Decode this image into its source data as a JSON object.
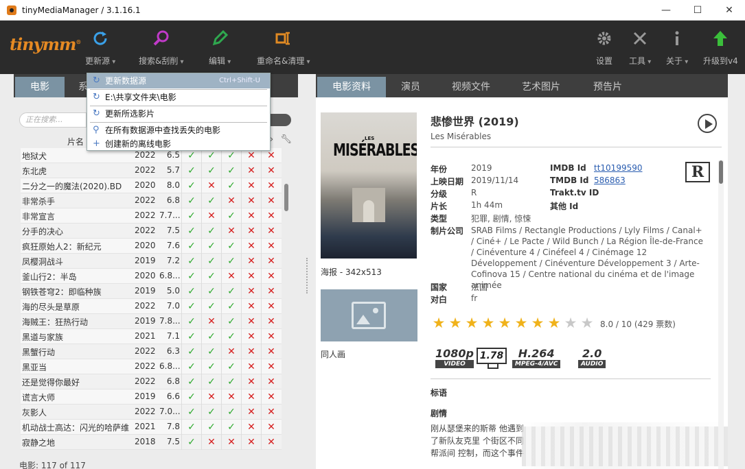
{
  "window": {
    "title": "tinyMediaManager / 3.1.16.1",
    "controls": [
      "—",
      "☐",
      "✕"
    ]
  },
  "toolbar": {
    "logo": "tinymm",
    "logo_mark": "®",
    "buttons": [
      {
        "label": "更新源",
        "icon": "refresh-icon"
      },
      {
        "label": "搜索&刮削",
        "icon": "search-icon"
      },
      {
        "label": "编辑",
        "icon": "pencil-icon"
      },
      {
        "label": "重命名&清理",
        "icon": "rename-icon"
      },
      {
        "label": "设置",
        "icon": "gear-icon"
      },
      {
        "label": "工具",
        "icon": "tools-icon"
      },
      {
        "label": "关于",
        "icon": "info-icon"
      },
      {
        "label": "升级到v4",
        "icon": "upgrade-arrow-icon"
      }
    ],
    "colors": {
      "refresh": "#3aa0e8",
      "search": "#c03ac8",
      "edit": "#2fa84f",
      "rename": "#e08a23",
      "upgrade": "#3bbf3b"
    }
  },
  "left": {
    "tabs": [
      "电影",
      "系"
    ],
    "search_placeholder": "正在搜索...",
    "column_header": "片名",
    "rows": [
      {
        "name": "地狱犬",
        "year": "2022",
        "rating": "6.5",
        "flags": [
          1,
          1,
          1,
          0,
          0
        ]
      },
      {
        "name": "东北虎",
        "year": "2022",
        "rating": "5.7",
        "flags": [
          1,
          1,
          1,
          0,
          0
        ]
      },
      {
        "name": "二分之一的魔法(2020).BD",
        "year": "2020",
        "rating": "8.0",
        "flags": [
          1,
          0,
          1,
          0,
          0
        ]
      },
      {
        "name": "非常杀手",
        "year": "2022",
        "rating": "6.8",
        "flags": [
          1,
          1,
          0,
          0,
          0
        ]
      },
      {
        "name": "非常宣言",
        "year": "2022",
        "rating": "7.7...",
        "flags": [
          1,
          0,
          1,
          0,
          0
        ]
      },
      {
        "name": "分手的决心",
        "year": "2022",
        "rating": "7.5",
        "flags": [
          1,
          1,
          0,
          0,
          0
        ]
      },
      {
        "name": "疯狂原始人2：新纪元",
        "year": "2020",
        "rating": "7.6",
        "flags": [
          1,
          1,
          1,
          0,
          0
        ]
      },
      {
        "name": "凤樱洞战斗",
        "year": "2019",
        "rating": "7.2",
        "flags": [
          1,
          1,
          1,
          0,
          0
        ]
      },
      {
        "name": "釜山行2：半岛",
        "year": "2020",
        "rating": "6.8...",
        "flags": [
          1,
          1,
          0,
          0,
          0
        ]
      },
      {
        "name": "钢铁苍穹2：即临种族",
        "year": "2019",
        "rating": "5.0",
        "flags": [
          1,
          1,
          1,
          0,
          0
        ]
      },
      {
        "name": "海的尽头是草原",
        "year": "2022",
        "rating": "7.0",
        "flags": [
          1,
          1,
          1,
          0,
          0
        ]
      },
      {
        "name": "海贼王：狂热行动",
        "year": "2019",
        "rating": "7.8...",
        "flags": [
          1,
          0,
          1,
          0,
          0
        ]
      },
      {
        "name": "黑道与家族",
        "year": "2021",
        "rating": "7.1",
        "flags": [
          1,
          1,
          1,
          0,
          0
        ]
      },
      {
        "name": "黑蟹行动",
        "year": "2022",
        "rating": "6.3",
        "flags": [
          1,
          1,
          0,
          0,
          0
        ]
      },
      {
        "name": "黑亚当",
        "year": "2022",
        "rating": "6.8...",
        "flags": [
          1,
          1,
          1,
          0,
          0
        ]
      },
      {
        "name": "还是觉得你最好",
        "year": "2022",
        "rating": "6.8",
        "flags": [
          1,
          1,
          1,
          0,
          0
        ]
      },
      {
        "name": "谎言大师",
        "year": "2019",
        "rating": "6.6",
        "flags": [
          1,
          0,
          0,
          0,
          0
        ]
      },
      {
        "name": "灰影人",
        "year": "2022",
        "rating": "7.0...",
        "flags": [
          1,
          1,
          1,
          0,
          0
        ]
      },
      {
        "name": "机动战士高达：闪光的哈萨维",
        "year": "2021",
        "rating": "7.8",
        "flags": [
          1,
          1,
          1,
          0,
          0
        ]
      },
      {
        "name": "寂静之地",
        "year": "2018",
        "rating": "7.5",
        "flags": [
          1,
          0,
          0,
          0,
          0
        ]
      }
    ],
    "status": "电影: 117  of  117"
  },
  "dropdown": {
    "items": [
      {
        "label": "更新数据源",
        "shortcut": "Ctrl+Shift-U",
        "icon": "refresh-icon"
      },
      {
        "label": "E:\\共享文件夹\\电影",
        "shortcut": "",
        "icon": "refresh-icon"
      },
      {
        "label": "更新所选影片",
        "shortcut": "",
        "icon": "refresh-icon"
      },
      {
        "label": "在所有数据源中查找丢失的电影",
        "shortcut": "",
        "icon": "search-icon"
      },
      {
        "label": "创建新的离线电影",
        "shortcut": "",
        "icon": "plus-icon"
      }
    ]
  },
  "right": {
    "tabs": [
      "电影资料",
      "演员",
      "视频文件",
      "艺术图片",
      "预告片"
    ],
    "poster_text_small": "LES",
    "poster_text_big": "MISÉRABLES",
    "poster_caption": "海报 - 342x513",
    "fanart_caption": "同人画",
    "title": "悲惨世界 (2019)",
    "original_title": "Les Misérables",
    "labels": {
      "year": "年份",
      "release": "上映日期",
      "cert": "分级",
      "runtime": "片长",
      "genre": "类型",
      "company": "制片公司",
      "country": "国家",
      "spoken": "对白",
      "imdb": "IMDB Id",
      "tmdb": "TMDB Id",
      "trakt": "Trakt.tv ID",
      "other": "其他 Id"
    },
    "values": {
      "year": "2019",
      "release": "2019/11/14",
      "cert": "R",
      "runtime": "1h 44m",
      "genre": "犯罪, 剧情, 惊悚",
      "company": "SRAB Films / Rectangle Productions / Lyly Films / Canal+ / Ciné+ / Le Pacte / Wild Bunch / La Région Île-de-France / Cinéventure 4 / Cinéfeel 4 / Cinémage 12 Développement / Cinéventure Développement 3 / Arte-Cofinova 15 / Centre national du cinéma et de l'image animée",
      "country": "法国",
      "spoken": "fr",
      "imdb": "tt10199590",
      "tmdb": "586863"
    },
    "rating_badge": "R",
    "stars": 8,
    "stars_total": 10,
    "rating_text": "8.0 / 10  (429 票数)",
    "media": {
      "resolution": "1080p",
      "resolution_sub": "VIDEO",
      "aspect": "1.78",
      "codec": "H.264",
      "codec_sub": "MPEG-4/AVC",
      "audio": "2.0",
      "audio_sub": "AUDIO"
    },
    "tagline_label": "标语",
    "plot_label": "剧情",
    "plot": "刚从瑟堡来的斯蒂 他遇到了新队友克里 个街区不同帮派间 控制，而这个事件"
  }
}
